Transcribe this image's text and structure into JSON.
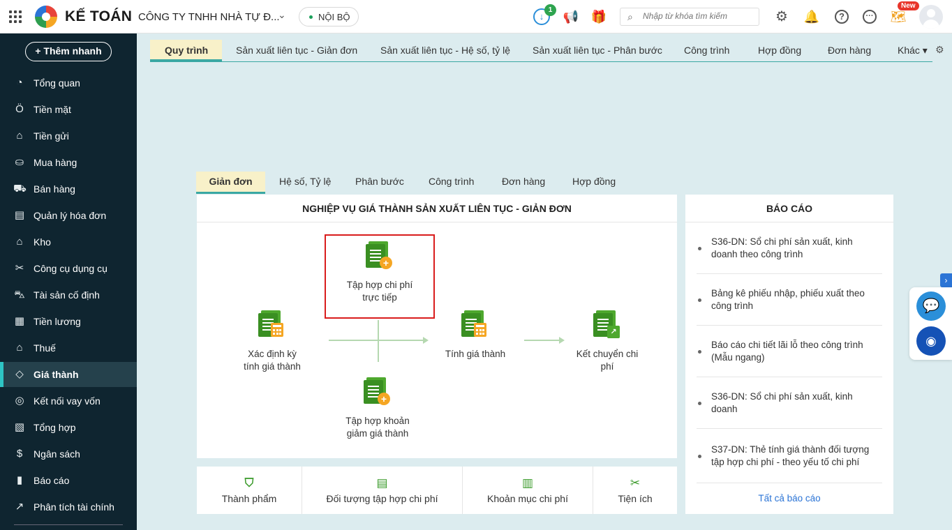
{
  "header": {
    "app_title": "KẾ TOÁN",
    "company": "CÔNG TY TNHH NHÀ TỰ Đ...",
    "scope": "NỘI BỘ",
    "download_badge": "1",
    "search_placeholder": "Nhập từ khóa tìm kiếm",
    "new_badge": "New",
    "icons": [
      "apps-grid-icon",
      "download-icon",
      "megaphone-icon",
      "gift-icon",
      "search-icon",
      "gear-icon",
      "bell-icon",
      "help-icon",
      "more-icon",
      "map-icon",
      "avatar"
    ]
  },
  "sidebar": {
    "quick_add": "+ Thêm nhanh",
    "items": [
      {
        "label": "Tổng quan",
        "icon": "◔"
      },
      {
        "label": "Tiền mặt",
        "icon": "Ö"
      },
      {
        "label": "Tiền gửi",
        "icon": "⌂"
      },
      {
        "label": "Mua hàng",
        "icon": "⛀"
      },
      {
        "label": "Bán hàng",
        "icon": "⛟"
      },
      {
        "label": "Quản lý hóa đơn",
        "icon": "▤"
      },
      {
        "label": "Kho",
        "icon": "⌂"
      },
      {
        "label": "Công cụ dụng cụ",
        "icon": "✂"
      },
      {
        "label": "Tài sản cố định",
        "icon": "⛍"
      },
      {
        "label": "Tiền lương",
        "icon": "▦"
      },
      {
        "label": "Thuế",
        "icon": "⌂"
      },
      {
        "label": "Giá thành",
        "icon": "◇"
      },
      {
        "label": "Kết nối vay vốn",
        "icon": "◎"
      },
      {
        "label": "Tổng hợp",
        "icon": "▧"
      },
      {
        "label": "Ngân sách",
        "icon": "$"
      },
      {
        "label": "Báo cáo",
        "icon": "▮"
      },
      {
        "label": "Phân tích tài chính",
        "icon": "↗"
      }
    ],
    "active_item": "Giá thành"
  },
  "main_tabs": {
    "items": [
      "Quy trình",
      "Sản xuất liên tục - Giản đơn",
      "Sản xuất liên tục - Hệ số, tỷ lệ",
      "Sản xuất liên tục - Phân bước",
      "Công trình",
      "Hợp đồng",
      "Đơn hàng",
      "Khác ▾"
    ],
    "active": "Quy trình"
  },
  "sub_tabs": {
    "items": [
      "Giản đơn",
      "Hệ số, Tỷ lệ",
      "Phân bước",
      "Công trình",
      "Đơn hàng",
      "Hợp đồng"
    ],
    "active": "Giản đơn"
  },
  "process": {
    "title": "NGHIỆP VỤ GIÁ THÀNH SẢN XUẤT LIÊN TỤC - GIẢN ĐƠN",
    "nodes": {
      "period": "Xác định kỳ\ntính giá thành",
      "direct_cost": "Tập hợp chi phí\ntrực tiếp",
      "reduction": "Tập hợp khoản\ngiảm giá thành",
      "calculate": "Tính giá thành",
      "transfer": "Kết chuyển chi\nphí"
    }
  },
  "utilities": [
    "Thành phẩm",
    "Đối tượng tập hợp chi phí",
    "Khoản mục chi phí",
    "Tiện ích"
  ],
  "reports": {
    "title": "BÁO CÁO",
    "items": [
      "S36-DN: Sổ chi phí sản xuất, kinh doanh theo công trình",
      "Bảng kê phiếu nhập, phiếu xuất theo công trình",
      "Báo cáo chi tiết lãi lỗ theo công trình (Mẫu ngang)",
      "S36-DN: Sổ chi phí sản xuất, kinh doanh",
      "S37-DN: Thẻ tính giá thành đối tượng tập hợp chi phí - theo yếu tố chi phí"
    ],
    "all_link": "Tất cả báo cáo"
  },
  "colors": {
    "sidebar_bg": "#0f2530",
    "accent_teal": "#3aa8a3",
    "active_tab_bg": "#f8f1c9",
    "highlight_red": "#d91c1c",
    "icon_green": "#3a9a2a"
  }
}
